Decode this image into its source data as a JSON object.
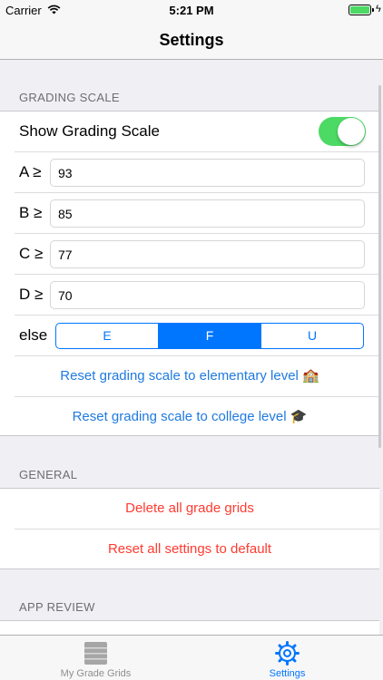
{
  "status_bar": {
    "carrier": "Carrier",
    "time": "5:21 PM"
  },
  "nav": {
    "title": "Settings"
  },
  "grading_scale": {
    "header": "GRADING SCALE",
    "show_label": "Show Grading Scale",
    "show_enabled": true,
    "grades": [
      {
        "label": "A ≥",
        "value": "93"
      },
      {
        "label": "B ≥",
        "value": "85"
      },
      {
        "label": "C ≥",
        "value": "77"
      },
      {
        "label": "D ≥",
        "value": "70"
      }
    ],
    "else_label": "else",
    "else_options": [
      "E",
      "F",
      "U"
    ],
    "else_selected": "F",
    "reset_elementary": "Reset grading scale to elementary level 🏫",
    "reset_college": "Reset grading scale to college level 🎓"
  },
  "general": {
    "header": "GENERAL",
    "delete_all": "Delete all grade grids",
    "reset_settings": "Reset all settings to default"
  },
  "app_review": {
    "header": "APP REVIEW"
  },
  "tab_bar": {
    "tabs": [
      {
        "label": "My Grade Grids",
        "icon": "grid-icon",
        "selected": false
      },
      {
        "label": "Settings",
        "icon": "gear-icon",
        "selected": true
      }
    ]
  },
  "colors": {
    "accent": "#0076ff",
    "link_blue": "#1f7ae0",
    "destructive": "#ff3b30",
    "toggle_on": "#4cd964",
    "background": "#efeff4"
  }
}
